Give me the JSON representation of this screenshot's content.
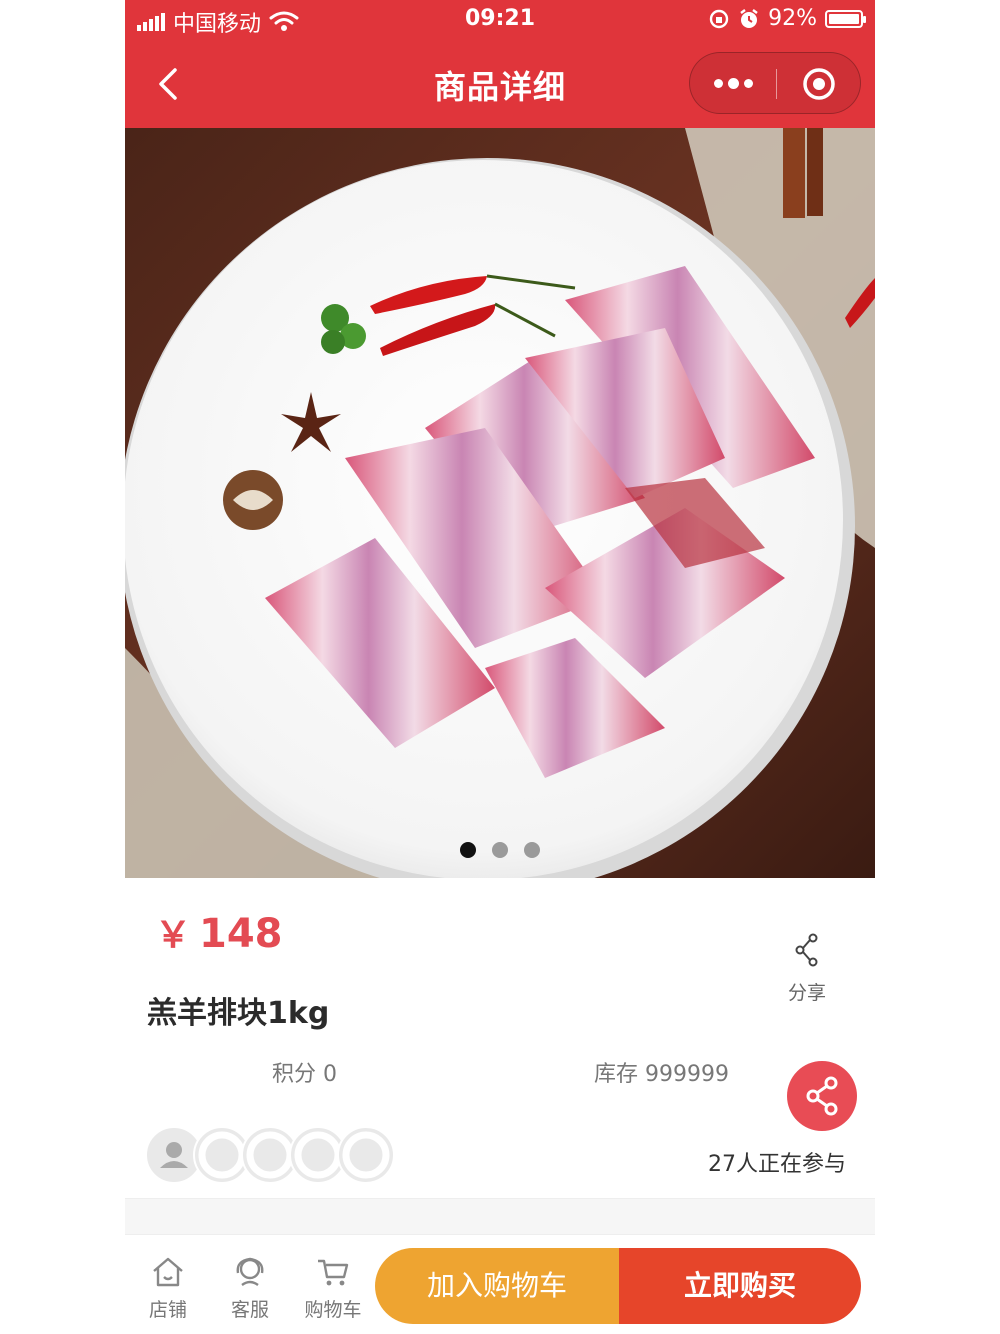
{
  "status": {
    "carrier": "中国移动",
    "time": "09:21",
    "battery": "92%"
  },
  "nav": {
    "title": "商品详细"
  },
  "gallery": {
    "slides": 3,
    "active_index": 0
  },
  "product": {
    "price_symbol": "￥",
    "price": "148",
    "name": "羔羊排块1kg",
    "points": "积分 0",
    "stock": "库存 999999",
    "participants": "27人正在参与"
  },
  "share": {
    "label": "分享"
  },
  "colors": {
    "brand_red": "#e0353b",
    "price_red": "#e34b53",
    "add_to_cart": "#eea431",
    "buy_now": "#e6452a"
  },
  "bottom_bar": {
    "tabs": [
      {
        "label": "店铺",
        "icon": "shop-icon"
      },
      {
        "label": "客服",
        "icon": "service-icon"
      },
      {
        "label": "购物车",
        "icon": "cart-icon"
      }
    ],
    "add_to_cart": "加入购物车",
    "buy_now": "立即购买"
  }
}
